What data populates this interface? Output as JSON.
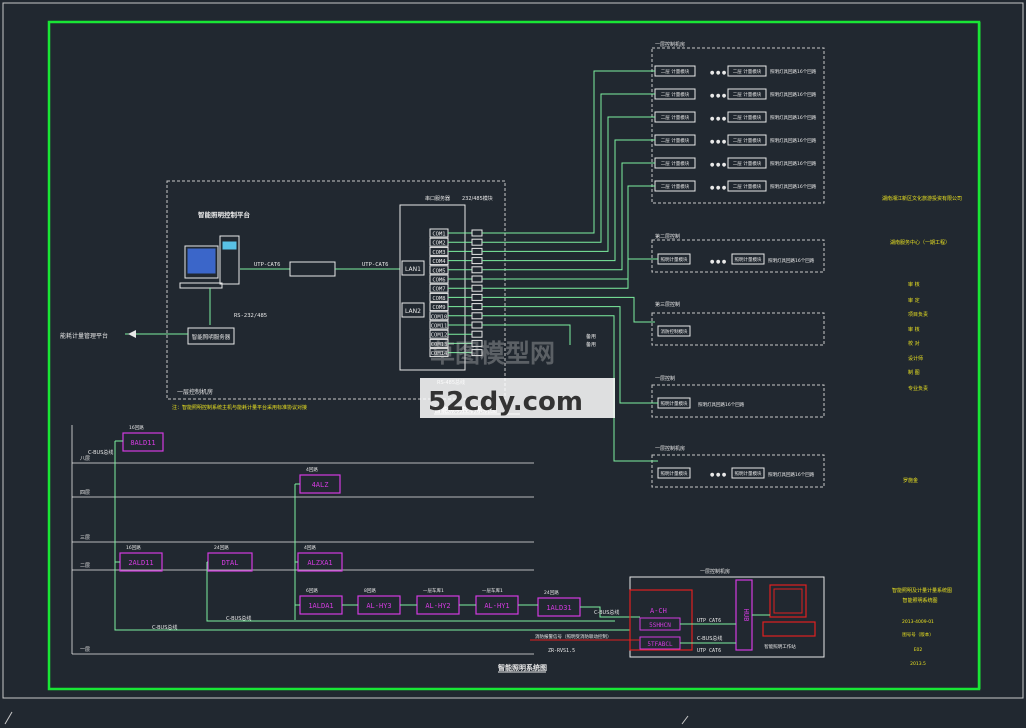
{
  "colors": {
    "background": "#212830",
    "frame": "#19e635",
    "line": "#7df0a0",
    "white": "#e8e8e8",
    "magenta": "#d33be0",
    "red": "#e02020",
    "yellow": "#e8e020",
    "dash": "#c8c8c8"
  },
  "platform": {
    "title": "智能照明控制平台",
    "link1": "UTP-CAT6",
    "link2": "UTP-CAT6",
    "rs": "RS-232/485",
    "gateway": "智能照明服务器",
    "external": "能耗计量管理平台",
    "lan1": "LAN1",
    "lan2": "LAN2",
    "room": "一层控制机房",
    "serverbox_label": "串口服务器",
    "serverbox_label2": "232/485模块",
    "bottom_label": "RS-485总线",
    "note": "注：智能照明控制系统主机与能耗计量平台采用标准协议对接"
  },
  "com_ports": [
    "COM1",
    "COM2",
    "COM3",
    "COM4",
    "COM5",
    "COM6",
    "COM7",
    "COM8",
    "COM9",
    "COM10",
    "COM11",
    "COM12",
    "COM13",
    "COM14"
  ],
  "diagram_title": "智能照明控制系统图",
  "watermark": {
    "line1": "草图模型网",
    "line2": "52cdy.com"
  },
  "floors": {
    "top_group_label": "一层控制机房",
    "top_rows": [
      "二层 计量模块",
      "二层 计量模块",
      "二层 计量模块",
      "二层 计量模块",
      "二层 计量模块",
      "二层 计量模块"
    ],
    "top_rows_right": [
      "照明灯具回路16个回路",
      "照明灯具回路16个回路",
      "照明灯具回路16个回路",
      "照明灯具回路16个回路",
      "照明灯具回路16个回路",
      "照明灯具回路16个回路"
    ],
    "mid_group_label": "第二层控制",
    "mid_row": "照明计量模块",
    "mid_row_right": "照明灯具回路16个回路",
    "g3_label": "第三层控制",
    "g3_row": "消防控制模块",
    "g4_label": "一层控制",
    "g4_row": "照明计量模块",
    "g4_row_right": "照明灯具回路16个回路",
    "g5_label": "一层控制机房",
    "g5_row": "照明计量模块",
    "g5_row_right": "照明灯具回路16个回路",
    "dots": "● ● ●",
    "feeder_top": "备用",
    "feeder_bottom": "备用"
  },
  "lighting": {
    "floor_labels": [
      "八层",
      "四层",
      "三层",
      "二层",
      "一层"
    ],
    "bus_label_top": "C-BUS总线",
    "bus_label_left": "C-BUS总线",
    "bus_label_mid": "C-BUS总线",
    "bus_label_right": "C-BUS总线",
    "cabinets": [
      "8ALD11",
      "4ALZ",
      "2ALD11",
      "DTAL",
      "ALZXA1",
      "1ALDA1",
      "AL-HY3",
      "AL-HY2",
      "AL-HY1",
      "1ALD31"
    ],
    "cab_labels": [
      "16回路",
      "4回路",
      "16回路",
      "24回路",
      "4回路",
      "6回路",
      "8回路",
      "一层车库1",
      "一层车库1",
      "24回路"
    ],
    "control_room": "一层控制机房",
    "a_ch": "A-CH",
    "units": [
      "5SHHCN",
      "5TFABCL"
    ],
    "hub": "HUB",
    "utp1": "UTP CAT6",
    "utp2": "UTP CAT6",
    "cbus": "C-BUS总线",
    "fire": "消防报警信号（照明受消防联动控制）",
    "zr": "ZR-RVS1.5",
    "workstation": "智能照明工作站",
    "sub_title": "智能照明系统图"
  },
  "title_block": {
    "company": "湖南湘江新区文化旅游投资有限公司",
    "project": "湖南服务中心（一期工程）",
    "roles": [
      "审 核",
      "审 定",
      "项目负责",
      "审 核",
      "校 对",
      "设计师",
      "制 图",
      "专业负责"
    ],
    "signer": "罗施金",
    "drawing_name_1": "智能照明及计量计量系统图",
    "drawing_name_2": "智能照明系统图",
    "number": "2013-4009-01",
    "scale": "图号号（版本）",
    "code": "E02",
    "date": "2013.5"
  }
}
